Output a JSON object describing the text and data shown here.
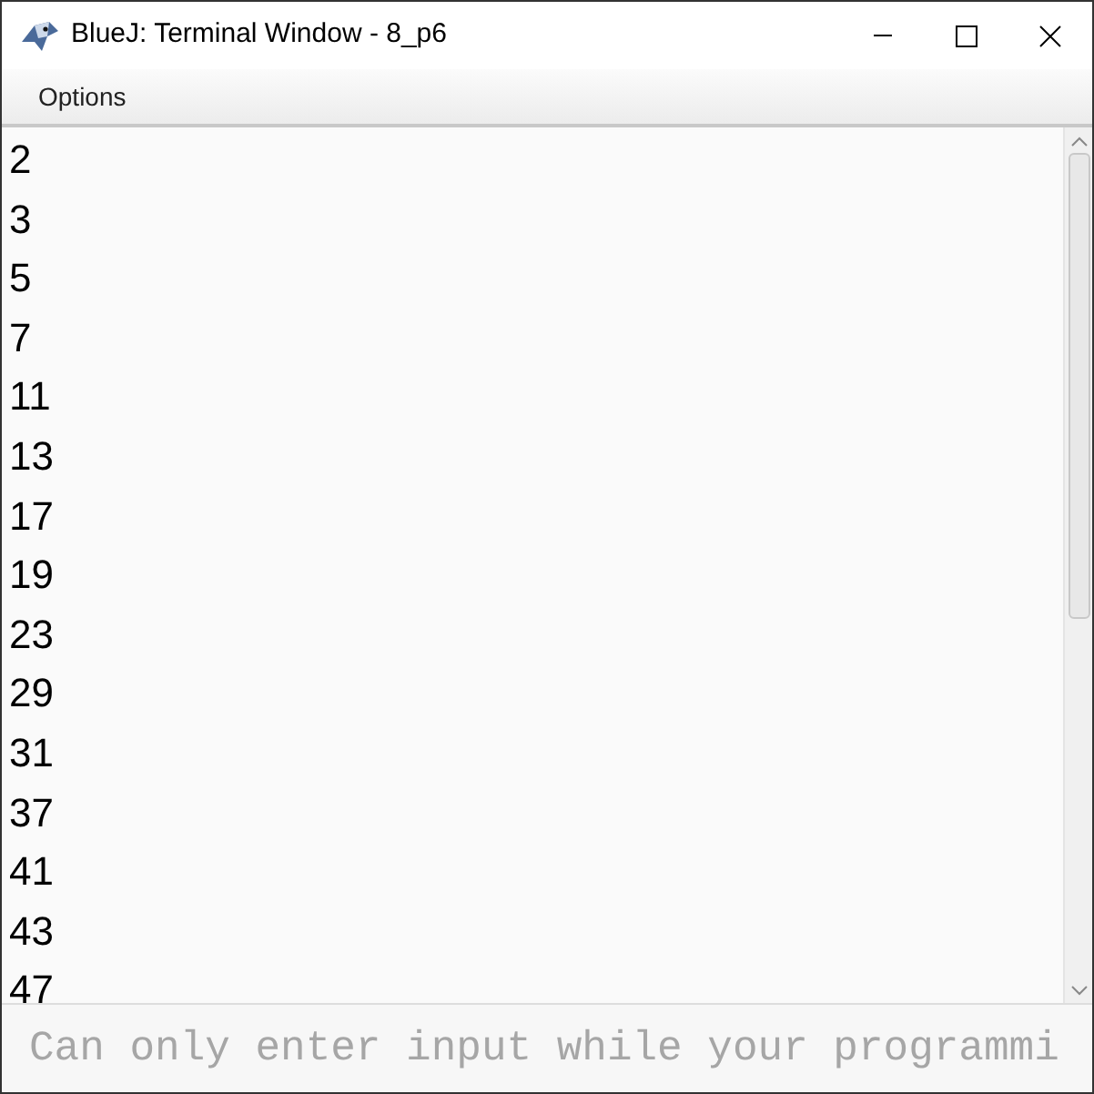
{
  "window": {
    "title": "BlueJ: Terminal Window - 8_p6"
  },
  "menu": [
    "Options"
  ],
  "output_lines": [
    "2",
    "3",
    "5",
    "7",
    "11",
    "13",
    "17",
    "19",
    "23",
    "29",
    "31",
    "37",
    "41",
    "43",
    "47"
  ],
  "input": {
    "placeholder": "Can only enter input while your programmi"
  }
}
